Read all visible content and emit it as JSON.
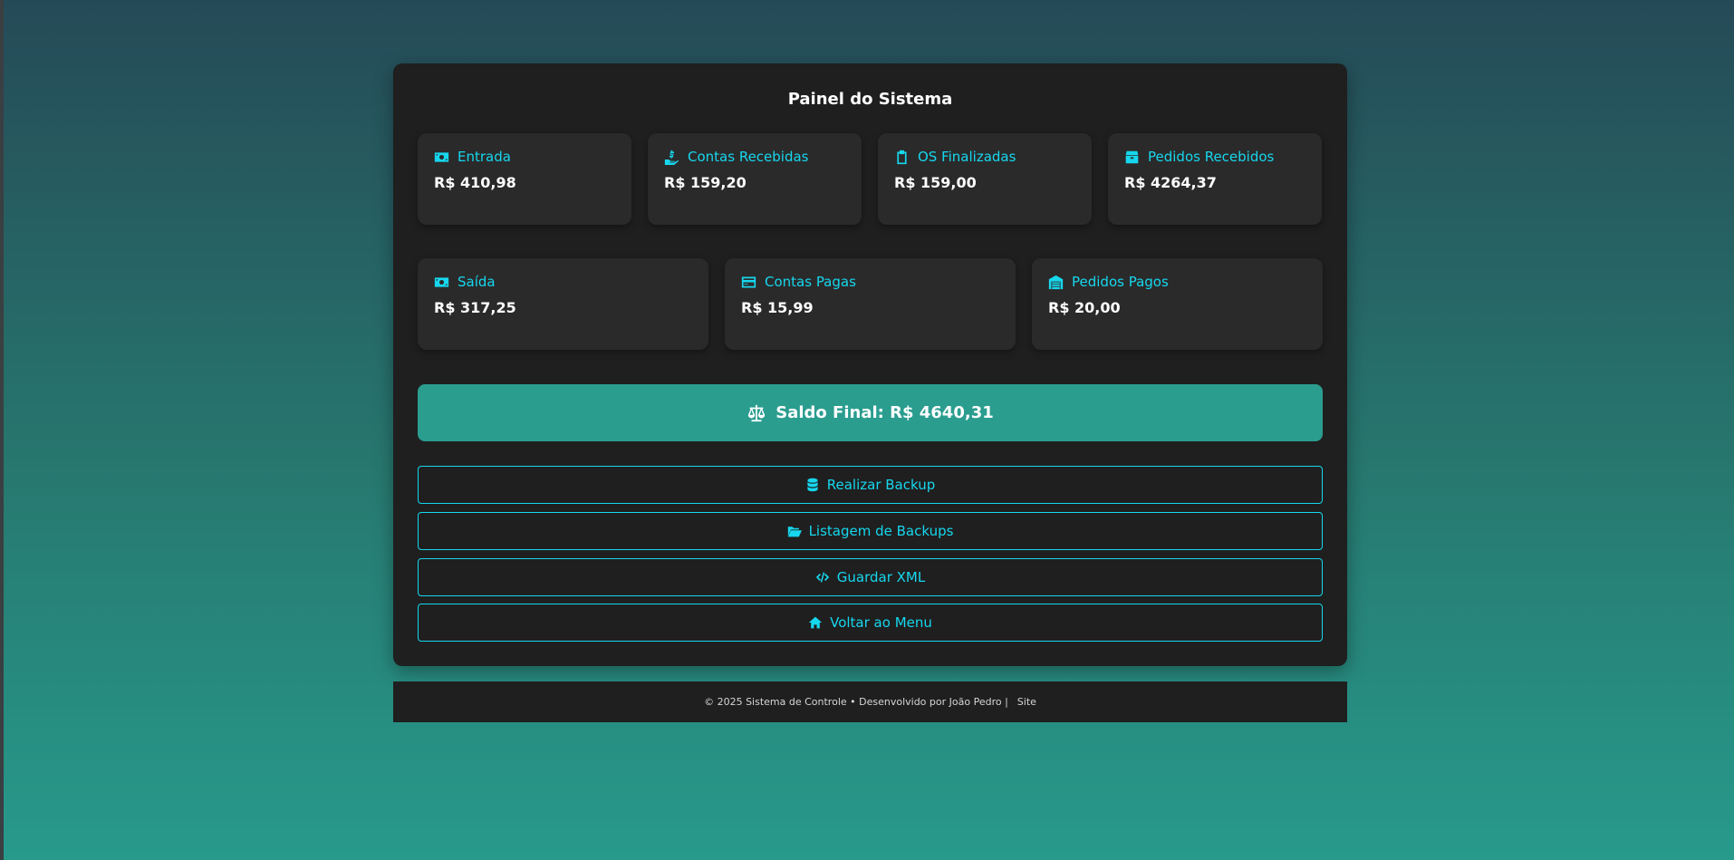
{
  "panel": {
    "title": "Painel do Sistema"
  },
  "cards_top": [
    {
      "label": "Entrada",
      "value": "R$ 410,98",
      "icon": "money-bill-icon"
    },
    {
      "label": "Contas Recebidas",
      "value": "R$ 159,20",
      "icon": "hand-holding-dollar-icon"
    },
    {
      "label": "OS Finalizadas",
      "value": "R$ 159,00",
      "icon": "clipboard-icon"
    },
    {
      "label": "Pedidos Recebidos",
      "value": "R$ 4264,37",
      "icon": "box-icon"
    }
  ],
  "cards_bottom": [
    {
      "label": "Saída",
      "value": "R$ 317,25",
      "icon": "money-bill-icon"
    },
    {
      "label": "Contas Pagas",
      "value": "R$ 15,99",
      "icon": "credit-card-icon"
    },
    {
      "label": "Pedidos Pagos",
      "value": "R$ 20,00",
      "icon": "warehouse-icon"
    }
  ],
  "saldo": {
    "text": "Saldo Final: R$ 4640,31",
    "icon": "scale-balanced-icon"
  },
  "actions": [
    {
      "label": "Realizar Backup",
      "icon": "database-icon"
    },
    {
      "label": "Listagem de Backups",
      "icon": "folder-open-icon"
    },
    {
      "label": "Guardar XML",
      "icon": "code-icon"
    },
    {
      "label": "Voltar ao Menu",
      "icon": "home-icon"
    }
  ],
  "footer": {
    "text": "© 2025 Sistema de Controle • Desenvolvido por João Pedro |",
    "link": "Site"
  },
  "colors": {
    "accent": "#16d7ee",
    "saldo_bg": "#2a9d8f",
    "panel_bg": "#1f1f1f",
    "card_bg": "#2a2a2a"
  }
}
